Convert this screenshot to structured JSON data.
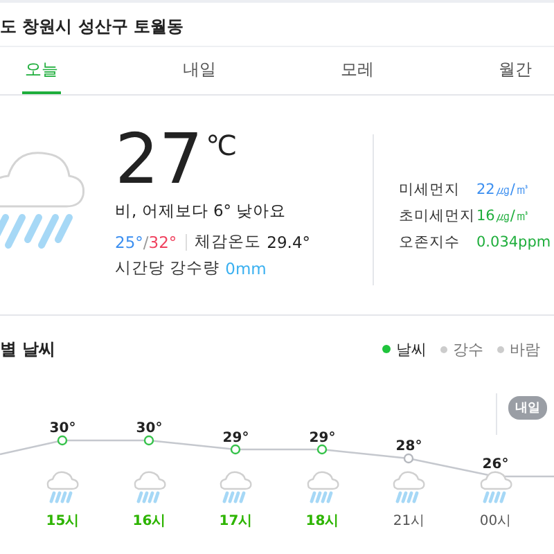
{
  "location": "도 창원시 성산구 토월동",
  "tabs": [
    {
      "label": "오늘",
      "selected": true
    },
    {
      "label": "내일",
      "selected": false
    },
    {
      "label": "모레",
      "selected": false
    },
    {
      "label": "월간",
      "selected": false
    }
  ],
  "current": {
    "temperature": "27",
    "unit": "℃",
    "summary": "비, 어제보다 6° 낮아요",
    "low": "25°",
    "separator": "/",
    "high": "32°",
    "feels_label": "체감온도",
    "feels_value": "29.4°",
    "rain_label": "시간당 강수량",
    "rain_value": "0mm"
  },
  "air": [
    {
      "label": "미세먼지",
      "value": "22㎍/㎥",
      "color": "#3c8ff0"
    },
    {
      "label": "초미세먼지",
      "value": "16㎍/㎥",
      "color": "#1fae3c"
    },
    {
      "label": "오존지수",
      "value": "0.034ppm",
      "color": "#1fae3c"
    }
  ],
  "hourly": {
    "title": "별 날씨",
    "legend": [
      {
        "label": "날씨",
        "selected": true
      },
      {
        "label": "강수",
        "selected": false
      },
      {
        "label": "바람",
        "selected": false
      }
    ],
    "next_day_tag": "내일",
    "hours": [
      {
        "temp": "30°",
        "time": "15시",
        "highlighted": true
      },
      {
        "temp": "30°",
        "time": "16시",
        "highlighted": true
      },
      {
        "temp": "29°",
        "time": "17시",
        "highlighted": true
      },
      {
        "temp": "29°",
        "time": "18시",
        "highlighted": true
      },
      {
        "temp": "28°",
        "time": "21시",
        "highlighted": false
      },
      {
        "temp": "26°",
        "time": "00시",
        "highlighted": false
      }
    ]
  }
}
